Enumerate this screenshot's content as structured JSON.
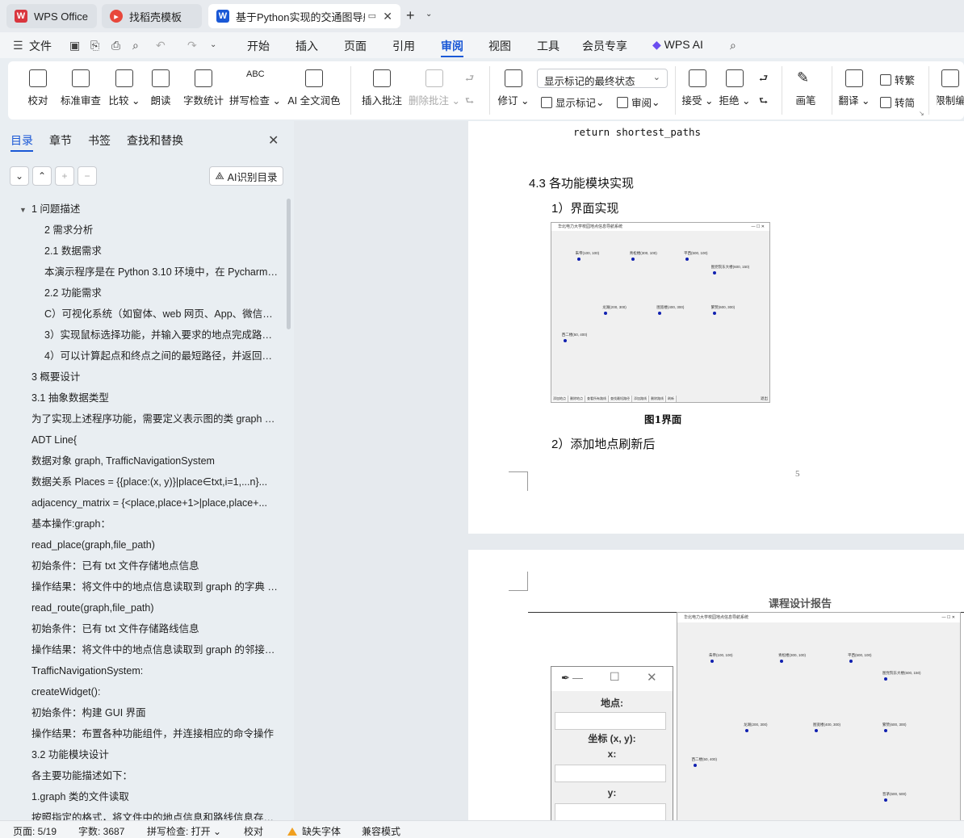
{
  "tabs": [
    {
      "label": "WPS Office",
      "icon": "wps-logo-icon",
      "color": "#d9363e"
    },
    {
      "label": "找稻壳模板",
      "icon": "docer-icon",
      "color": "#e8473b"
    },
    {
      "label": "基于Python实现的交通图导航",
      "icon": "word-doc-icon",
      "color": "#1a58d6"
    }
  ],
  "menu": {
    "file": "文件",
    "items": [
      "开始",
      "插入",
      "页面",
      "引用",
      "审阅",
      "视图",
      "工具",
      "会员专享"
    ],
    "active": "审阅",
    "wps_ai": "WPS AI"
  },
  "ribbon": {
    "proofread": "校对",
    "standard_review": "标准审查",
    "compare": "比较",
    "read_aloud": "朗读",
    "word_count": "字数统计",
    "spell_check": "拼写检查",
    "ai_polish": "AI 全文润色",
    "insert_comment": "插入批注",
    "delete_comment": "删除批注",
    "revise": "修订",
    "markup_select": "显示标记的最终状态",
    "show_markup": "显示标记",
    "review": "审阅",
    "accept": "接受",
    "reject": "拒绝",
    "brush": "画笔",
    "translate": "翻译",
    "to_traditional": "转繁",
    "to_simplified": "转简",
    "restrict": "限制编"
  },
  "sidebar": {
    "tabs": [
      "目录",
      "章节",
      "书签",
      "查找和替换"
    ],
    "ai_toc": "AI识别目录",
    "toc": [
      {
        "text": "1 问题描述",
        "level": 0,
        "caret": true
      },
      {
        "text": "2 需求分析",
        "level": 1
      },
      {
        "text": "2.1 数据需求",
        "level": 1
      },
      {
        "text": "本演示程序是在 Python 3.10 环境中，在 Pycharm 中...",
        "level": 1
      },
      {
        "text": "2.2 功能需求",
        "level": 1
      },
      {
        "text": "C）可视化系统（如窗体、web 网页、App、微信小程序...",
        "level": 1
      },
      {
        "text": "3）实现鼠标选择功能，并输入要求的地点完成路线...",
        "level": 1
      },
      {
        "text": "4）可以计算起点和终点之间的最短路径，并返回路...",
        "level": 1
      },
      {
        "text": "3 概要设计",
        "level": 0
      },
      {
        "text": "3.1 抽象数据类型",
        "level": 0
      },
      {
        "text": "为了实现上述程序功能，需要定义表示图的类 graph 和...",
        "level": 0
      },
      {
        "text": "ADT Line{",
        "level": 0
      },
      {
        "text": "数据对象    graph, TrafficNavigationSystem",
        "level": 0
      },
      {
        "text": "数据关系    Places = {{place:(x, y)}|place∈txt,i=1,...n}...",
        "level": 0
      },
      {
        "text": "adjacency_matrix = {<place,place+1>|place,place+...",
        "level": 0
      },
      {
        "text": "基本操作:graph：",
        "level": 0
      },
      {
        "text": "read_place(graph,file_path)",
        "level": 0
      },
      {
        "text": "初始条件：已有 txt 文件存储地点信息",
        "level": 0
      },
      {
        "text": "操作结果：将文件中的地点信息读取到 graph 的字典 p...",
        "level": 0
      },
      {
        "text": "read_route(graph,file_path)",
        "level": 0
      },
      {
        "text": "初始条件：已有 txt 文件存储路线信息",
        "level": 0
      },
      {
        "text": "操作结果：将文件中的地点信息读取到 graph 的邻接矩...",
        "level": 0
      },
      {
        "text": "TrafficNavigationSystem:",
        "level": 0
      },
      {
        "text": "createWidget():",
        "level": 0
      },
      {
        "text": "初始条件：构建 GUI 界面",
        "level": 0
      },
      {
        "text": "操作结果：布置各种功能组件，并连接相应的命令操作",
        "level": 0
      },
      {
        "text": "3.2 功能模块设计",
        "level": 0
      },
      {
        "text": "各主要功能描述如下：",
        "level": 0
      },
      {
        "text": "1.graph 类的文件读取",
        "level": 0
      },
      {
        "text": "按照指定的格式，将文件中的地点信息和路线信息存入...",
        "level": 0
      }
    ]
  },
  "document": {
    "code_line": "return shortest_paths",
    "section_heading": "4.3 各功能模块实现",
    "sub1": "1）界面实现",
    "figure_caption": "图1界面",
    "sub2": "2）添加地点刷新后",
    "page_number": "5",
    "page2_header": "课程设计报告",
    "app_title": "华北电力大学校园地点信息导航系统",
    "places": [
      {
        "name": "朱帝(100, 100)"
      },
      {
        "name": "青松楼(300, 100)"
      },
      {
        "name": "平西(500, 100)"
      },
      {
        "name": "图党院东大楼(600, 150)"
      },
      {
        "name": "龙湖(200, 300)"
      },
      {
        "name": "图宽楼(400, 300)"
      },
      {
        "name": "繁赞(600, 300)"
      },
      {
        "name": "西二楼(50, 400)"
      }
    ],
    "place_extra": "晋茅(600, 500)",
    "app_buttons": [
      "添加地点",
      "删除地点",
      "查看所有路线",
      "查找最短路径",
      "添加路线",
      "删除路线",
      "刷新"
    ],
    "exit_label": "退出",
    "dialog": {
      "place_label": "地点:",
      "coord_label": "坐标 (x, y):",
      "x_label": "x:",
      "y_label": "y:"
    }
  },
  "status": {
    "page": "页面: 5/19",
    "words": "字数: 3687",
    "spell": "拼写检查: 打开",
    "proof": "校对",
    "missing_font": "缺失字体",
    "compat": "兼容模式"
  }
}
